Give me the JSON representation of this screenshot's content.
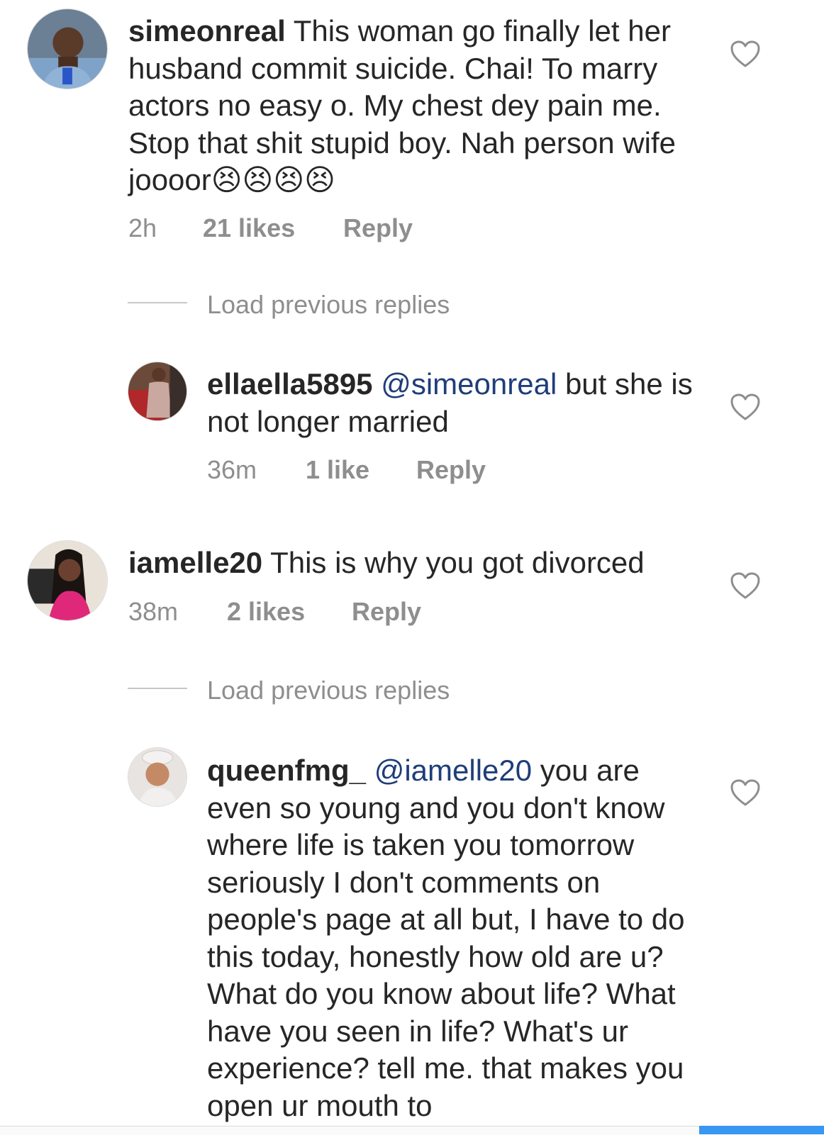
{
  "comments": [
    {
      "username": "simeonreal",
      "text": "This woman go finally let her husband commit suicide. Chai! To marry actors no easy o. My chest dey pain me. Stop that shit stupid boy. Nah person wife joooor😣😣😣😣",
      "time": "2h",
      "likes": "21 likes",
      "reply": "Reply"
    },
    {
      "username": "ellaella5895",
      "mention": "@simeonreal",
      "text": "but she is not longer married",
      "time": "36m",
      "likes": "1 like",
      "reply": "Reply"
    },
    {
      "username": "iamelle20",
      "text": "This is why you got divorced",
      "time": "38m",
      "likes": "2 likes",
      "reply": "Reply"
    },
    {
      "username": "queenfmg_",
      "mention": "@iamelle20",
      "text": "you are even so young and you don't know where life  is taken you tomorrow seriously I don't comments on people's page at all but,  I have to do this today, honestly how old are u? What do you know about life? What have you seen in life? What's ur experience? tell me. that makes you open ur mouth to"
    }
  ],
  "load_previous": [
    "Load previous replies",
    "Load previous replies"
  ],
  "icons": {
    "like": "heart-outline-icon"
  },
  "colors": {
    "text": "#262626",
    "meta": "#8e8e8e",
    "mention": "#1f3d7a",
    "accent": "#3897f0"
  }
}
